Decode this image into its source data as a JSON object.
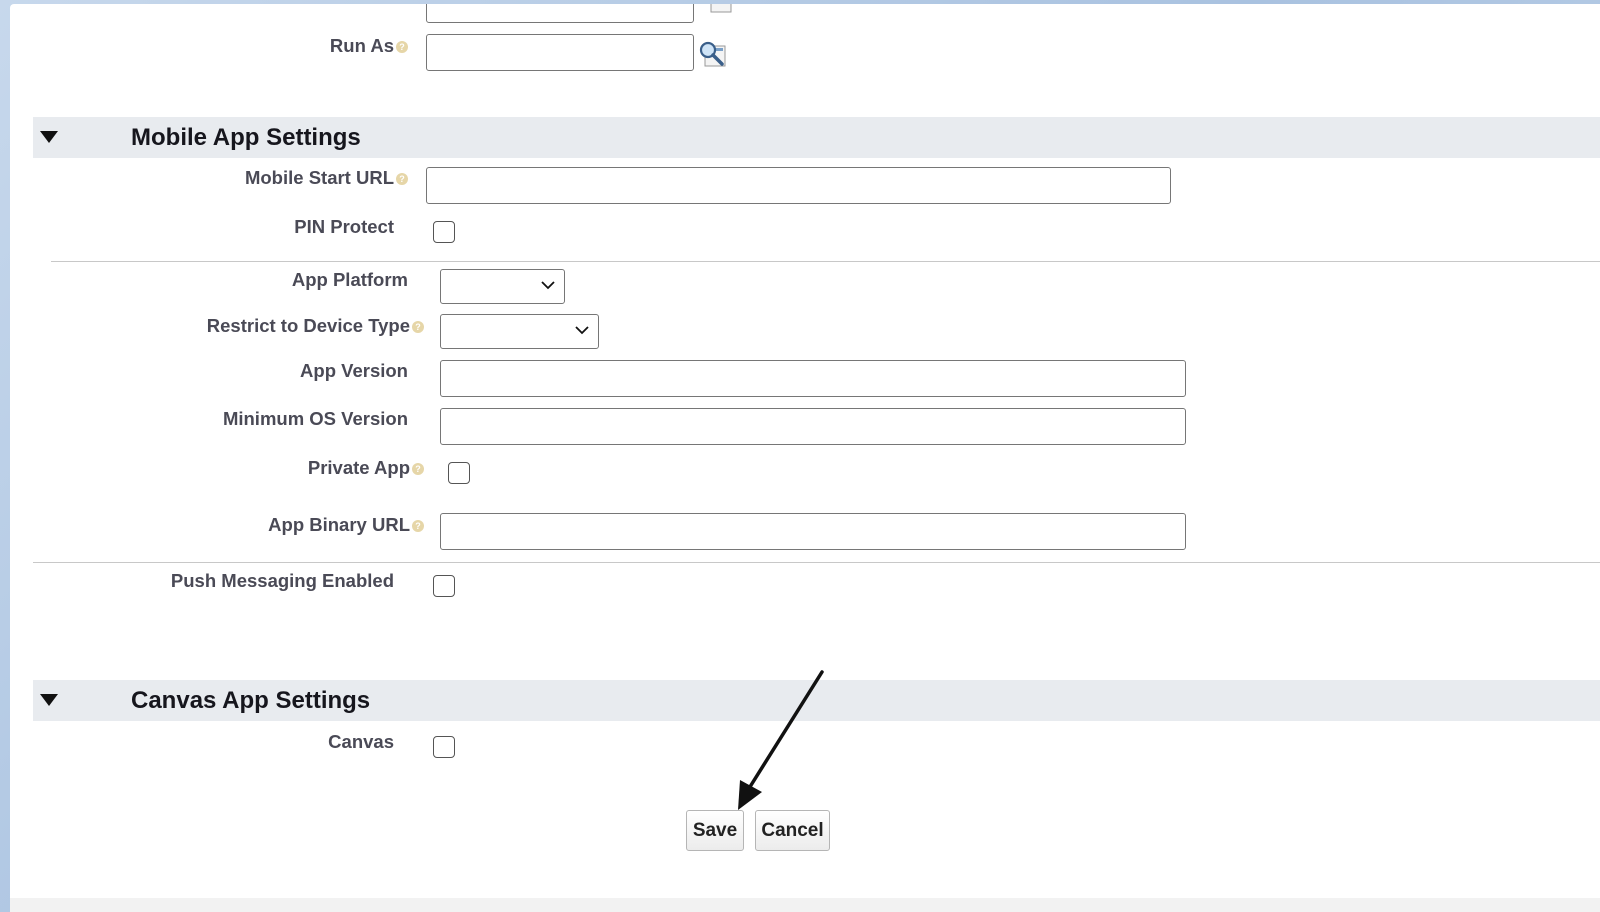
{
  "top_fields": {
    "run_as_label": "Run As"
  },
  "mobile_section": {
    "title": "Mobile App Settings",
    "mobile_start_url_label": "Mobile Start URL",
    "pin_protect_label": "PIN Protect",
    "app_platform_label": "App Platform",
    "restrict_device_label": "Restrict to Device Type",
    "app_version_label": "App Version",
    "min_os_label": "Minimum OS Version",
    "private_app_label": "Private App",
    "app_binary_url_label": "App Binary URL",
    "push_messaging_label": "Push Messaging Enabled"
  },
  "canvas_section": {
    "title": "Canvas App Settings",
    "canvas_label": "Canvas"
  },
  "actions": {
    "save_label": "Save",
    "cancel_label": "Cancel"
  },
  "icons": {
    "help": "help-icon",
    "lookup": "lookup-search-icon",
    "collapse": "collapse-triangle-icon",
    "dropdown": "chevron-down-icon",
    "annotation": "annotation-arrow"
  },
  "colors": {
    "section_header_bg": "#e8ebef",
    "label_text": "#4a4a56",
    "help_icon": "#e6d6a8",
    "backdrop": "#b8cde6"
  }
}
